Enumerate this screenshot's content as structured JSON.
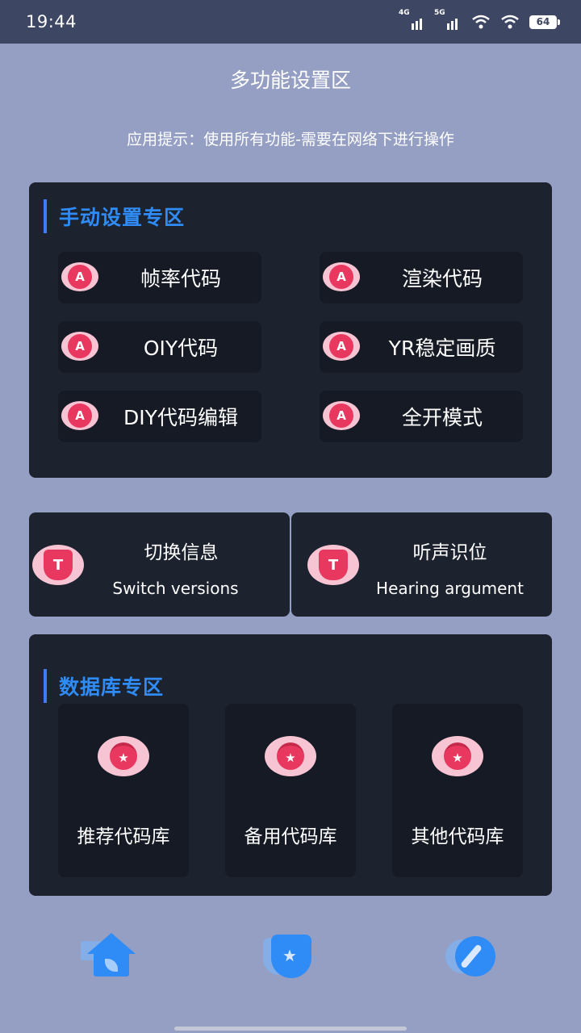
{
  "status_bar": {
    "time": "19:44",
    "signal1_label": "4G",
    "signal2_label": "5G",
    "battery": "64",
    "icons": [
      "signal-icon",
      "signal-icon",
      "wifi-icon",
      "wifi-icon",
      "battery-icon"
    ]
  },
  "page": {
    "title": "多功能设置区",
    "hint": "应用提示：使用所有功能-需要在网络下进行操作"
  },
  "manual_section": {
    "heading": "手动设置专区",
    "buttons": [
      {
        "label": "帧率代码",
        "icon": "a-badge-icon"
      },
      {
        "label": "渲染代码",
        "icon": "a-badge-icon"
      },
      {
        "label": "OIY代码",
        "icon": "a-badge-icon"
      },
      {
        "label": "YR稳定画质",
        "icon": "a-badge-icon"
      },
      {
        "label": "DIY代码编辑",
        "icon": "a-badge-icon"
      },
      {
        "label": "全开模式",
        "icon": "a-badge-icon"
      }
    ],
    "icon_glyph": "A"
  },
  "wide_cards": [
    {
      "title": "切换信息",
      "subtitle": "Switch versions",
      "icon": "t-shield-icon"
    },
    {
      "title": "听声识位",
      "subtitle": "Hearing argument",
      "icon": "t-shield-icon"
    }
  ],
  "wide_icon_glyph": "T",
  "database_section": {
    "heading": "数据库专区",
    "cards": [
      {
        "label": "推荐代码库",
        "icon": "medal-icon"
      },
      {
        "label": "备用代码库",
        "icon": "medal-icon"
      },
      {
        "label": "其他代码库",
        "icon": "medal-icon"
      }
    ],
    "medal_glyph": "★"
  },
  "bottom_nav": [
    {
      "name": "home-icon"
    },
    {
      "name": "shield-star-icon"
    },
    {
      "name": "compass-icon"
    }
  ],
  "colors": {
    "background": "#949fc3",
    "status_bar": "#3d4662",
    "panel": "#1c222e",
    "button": "#161a24",
    "accent_blue": "#2f8cf6",
    "accent_pink": "#e8385f"
  }
}
